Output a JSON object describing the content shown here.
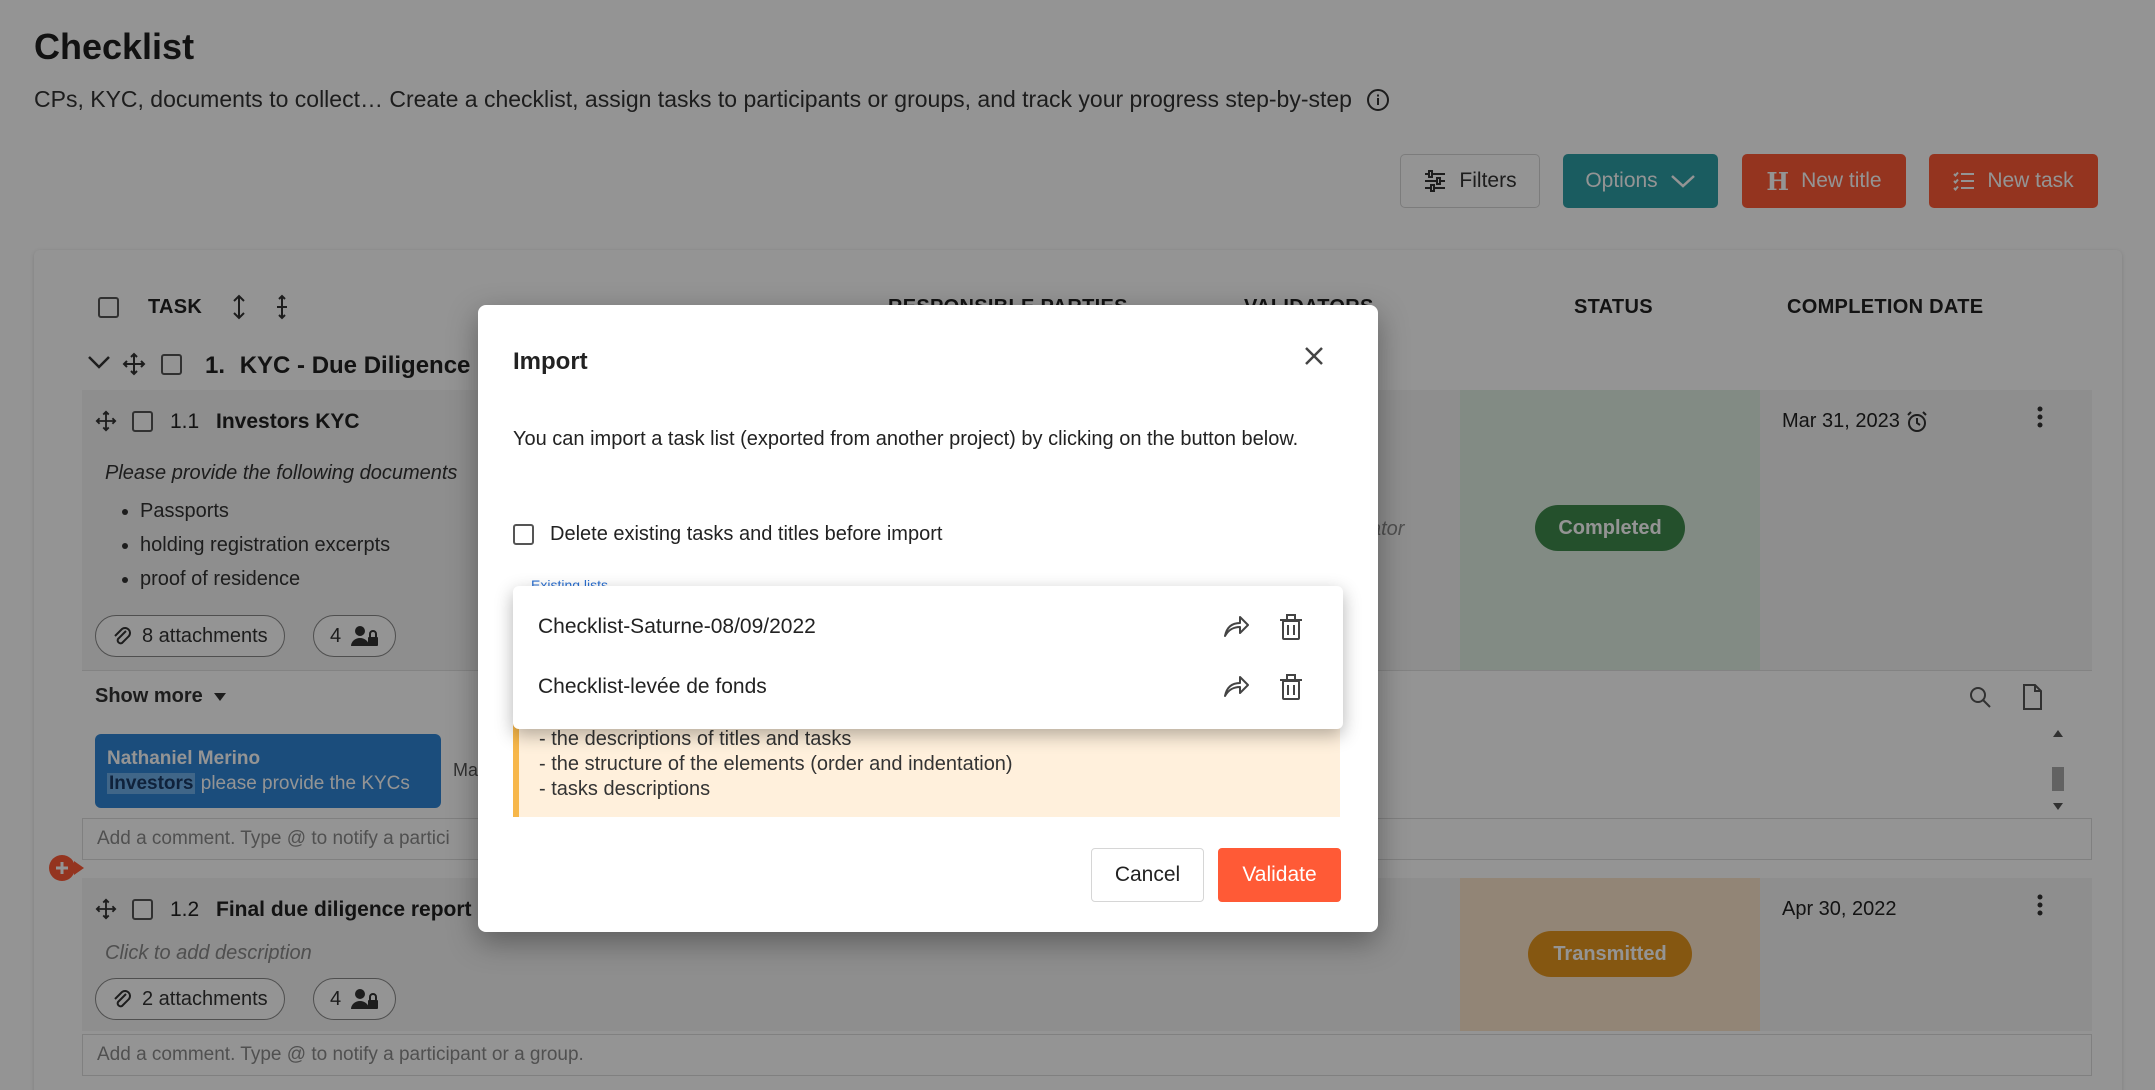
{
  "header": {
    "title": "Checklist",
    "subtitle": "CPs, KYC, documents to collect… Create a checklist, assign tasks to participants or groups, and track your progress step-by-step"
  },
  "toolbar": {
    "filters_label": "Filters",
    "options_label": "Options",
    "new_title_label": "New title",
    "new_task_label": "New task"
  },
  "table": {
    "columns": {
      "task": "TASK",
      "responsible": "RESPONSIBLE PARTIES",
      "validators": "VALIDATORS",
      "status": "STATUS",
      "completion": "COMPLETION DATE"
    },
    "section": {
      "number": "1.",
      "title": "KYC - Due Diligence"
    },
    "tasks": [
      {
        "number": "1.1",
        "title": "Investors KYC",
        "description": "Please provide the following documents",
        "bullets": [
          "Passports",
          "holding registration excerpts",
          "proof of residence"
        ],
        "attachments": "8 attachments",
        "participants": "4",
        "validator_hint": "ator",
        "status": "Completed",
        "date": "Mar 31, 2023",
        "show_more": "Show more",
        "comment": {
          "author": "Nathaniel Merino",
          "group": "Investors",
          "text": "please provide the KYCs",
          "meta": "Ma"
        },
        "comment_placeholder": "Add a comment. Type @ to notify a partici"
      },
      {
        "number": "1.2",
        "title": "Final due diligence report",
        "description": "Click to add description",
        "attachments": "2 attachments",
        "participants": "4",
        "status": "Transmitted",
        "date": "Apr 30, 2022",
        "comment_placeholder": "Add a comment. Type @ to notify a participant or a group."
      }
    ]
  },
  "modal": {
    "title": "Import",
    "description": "You can import a task list (exported from another project) by clicking on the button below.",
    "delete_checkbox_label": "Delete existing tasks and titles before import",
    "field_label": "Existing lists",
    "warning_lines": [
      "- the descriptions of titles and tasks",
      "- the structure of the elements (order and indentation)",
      "- tasks descriptions"
    ],
    "cancel_label": "Cancel",
    "validate_label": "Validate"
  },
  "dropdown": {
    "items": [
      {
        "label": "Checklist-Saturne-08/09/2022"
      },
      {
        "label": "Checklist-levée de fonds"
      }
    ]
  },
  "colors": {
    "accent": "#ff5a36",
    "teal": "#2e9fa6",
    "completed": "#3f8a4d",
    "transmitted": "#e6961e",
    "comment_bubble": "#2f86d6"
  }
}
